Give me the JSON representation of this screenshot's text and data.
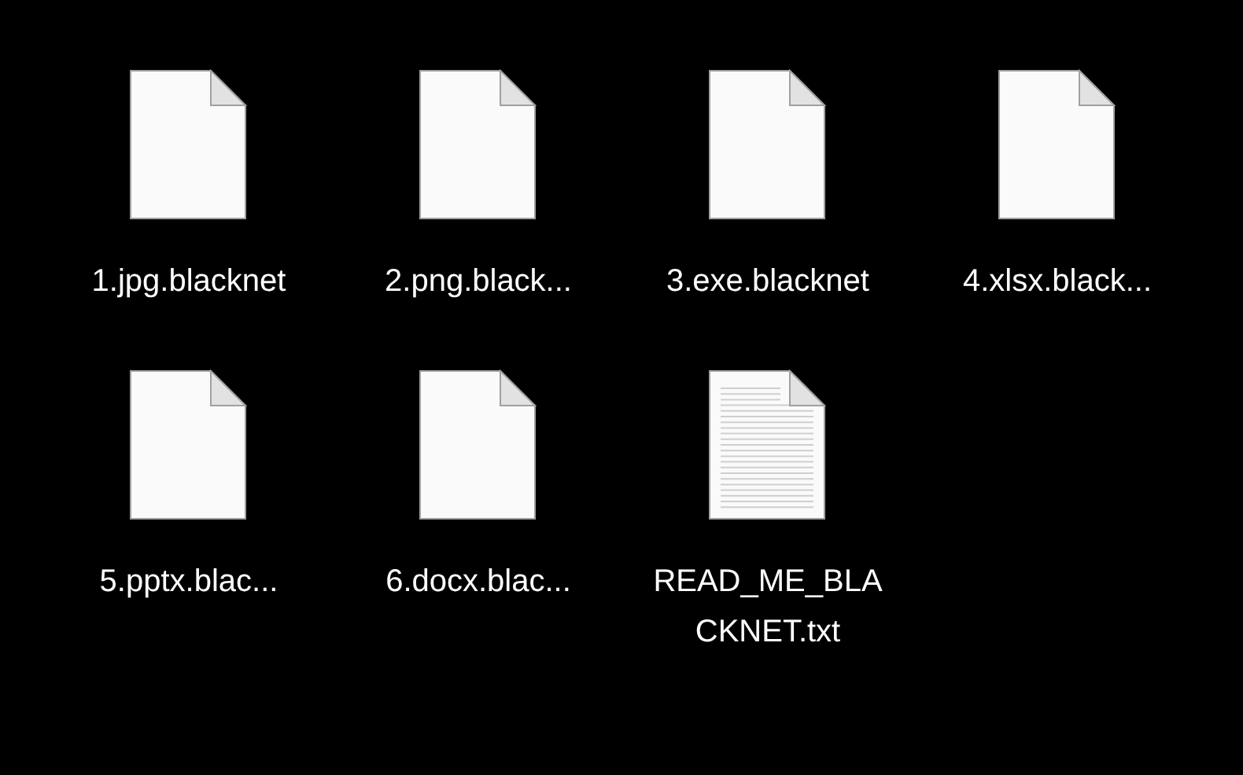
{
  "files": [
    {
      "name": "1.jpg.blacknet",
      "kind": "blank"
    },
    {
      "name": "2.png.black...",
      "kind": "blank"
    },
    {
      "name": "3.exe.blacknet",
      "kind": "blank"
    },
    {
      "name": "4.xlsx.black...",
      "kind": "blank"
    },
    {
      "name": "5.pptx.blac...",
      "kind": "blank"
    },
    {
      "name": "6.docx.blac...",
      "kind": "blank"
    },
    {
      "name": "READ_ME_BLACKNET.txt",
      "kind": "text"
    }
  ]
}
